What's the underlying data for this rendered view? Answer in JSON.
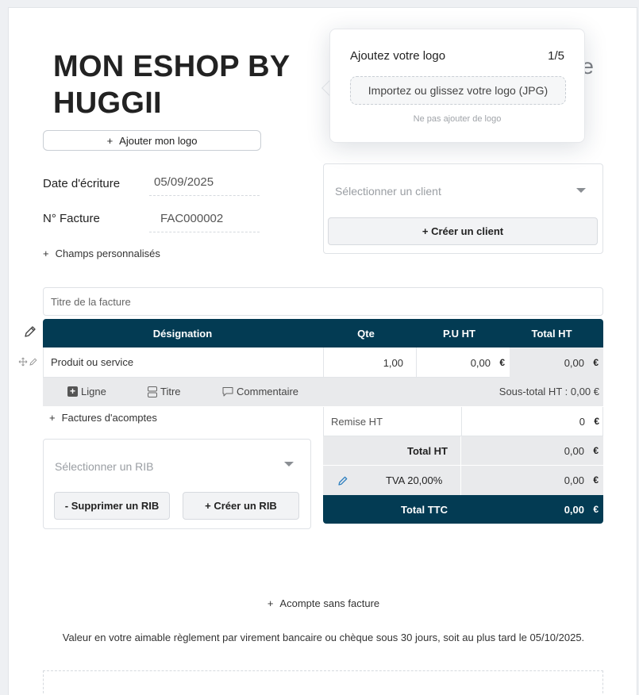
{
  "company_name": "MON ESHOP BY HUGGII",
  "add_logo_label": "Ajouter mon logo",
  "doc_title_peek": "re",
  "logo_popover": {
    "title": "Ajoutez votre logo",
    "step": "1/5",
    "upload_label": "Importez ou glissez votre logo (JPG)",
    "skip_label": "Ne pas ajouter de logo"
  },
  "fields": {
    "date_label": "Date d'écriture",
    "date_value": "05/09/2025",
    "number_label": "N° Facture",
    "number_value": "FAC000002",
    "custom_fields_label": "Champs personnalisés"
  },
  "client": {
    "placeholder": "Sélectionner un client",
    "create_label": "+ Créer un client"
  },
  "invoice_title_placeholder": "Titre de la facture",
  "table": {
    "headers": [
      "Désignation",
      "Qte",
      "P.U HT",
      "Total HT"
    ],
    "rows": [
      {
        "designation": "Produit ou service",
        "qty": "1,00",
        "unit_price": "0,00",
        "total": "0,00",
        "currency": "€"
      }
    ],
    "footer": {
      "line_label": "Ligne",
      "title_label": "Titre",
      "comment_label": "Commentaire",
      "subtotal": "Sous-total HT : 0,00 €"
    }
  },
  "deposits_label": "Factures d'acomptes",
  "rib": {
    "placeholder": "Sélectionner un RIB",
    "delete_label": "- Supprimer un RIB",
    "create_label": "+ Créer un RIB"
  },
  "totals": {
    "discount_label": "Remise HT",
    "discount_value": "0",
    "total_ht_label": "Total HT",
    "total_ht_value": "0,00",
    "tva_label": "TVA 20,00%",
    "tva_value": "0,00",
    "total_ttc_label": "Total TTC",
    "total_ttc_value": "0,00",
    "currency": "€"
  },
  "acompte_label": "Acompte sans facture",
  "payment_terms": "Valeur en votre aimable règlement par virement bancaire ou chèque sous 30 jours, soit au plus tard le 05/10/2025.",
  "colors": {
    "header_dark": "#033b53",
    "grey_cell": "#e9eaec",
    "edit_pencil": "#2d7fbf"
  }
}
